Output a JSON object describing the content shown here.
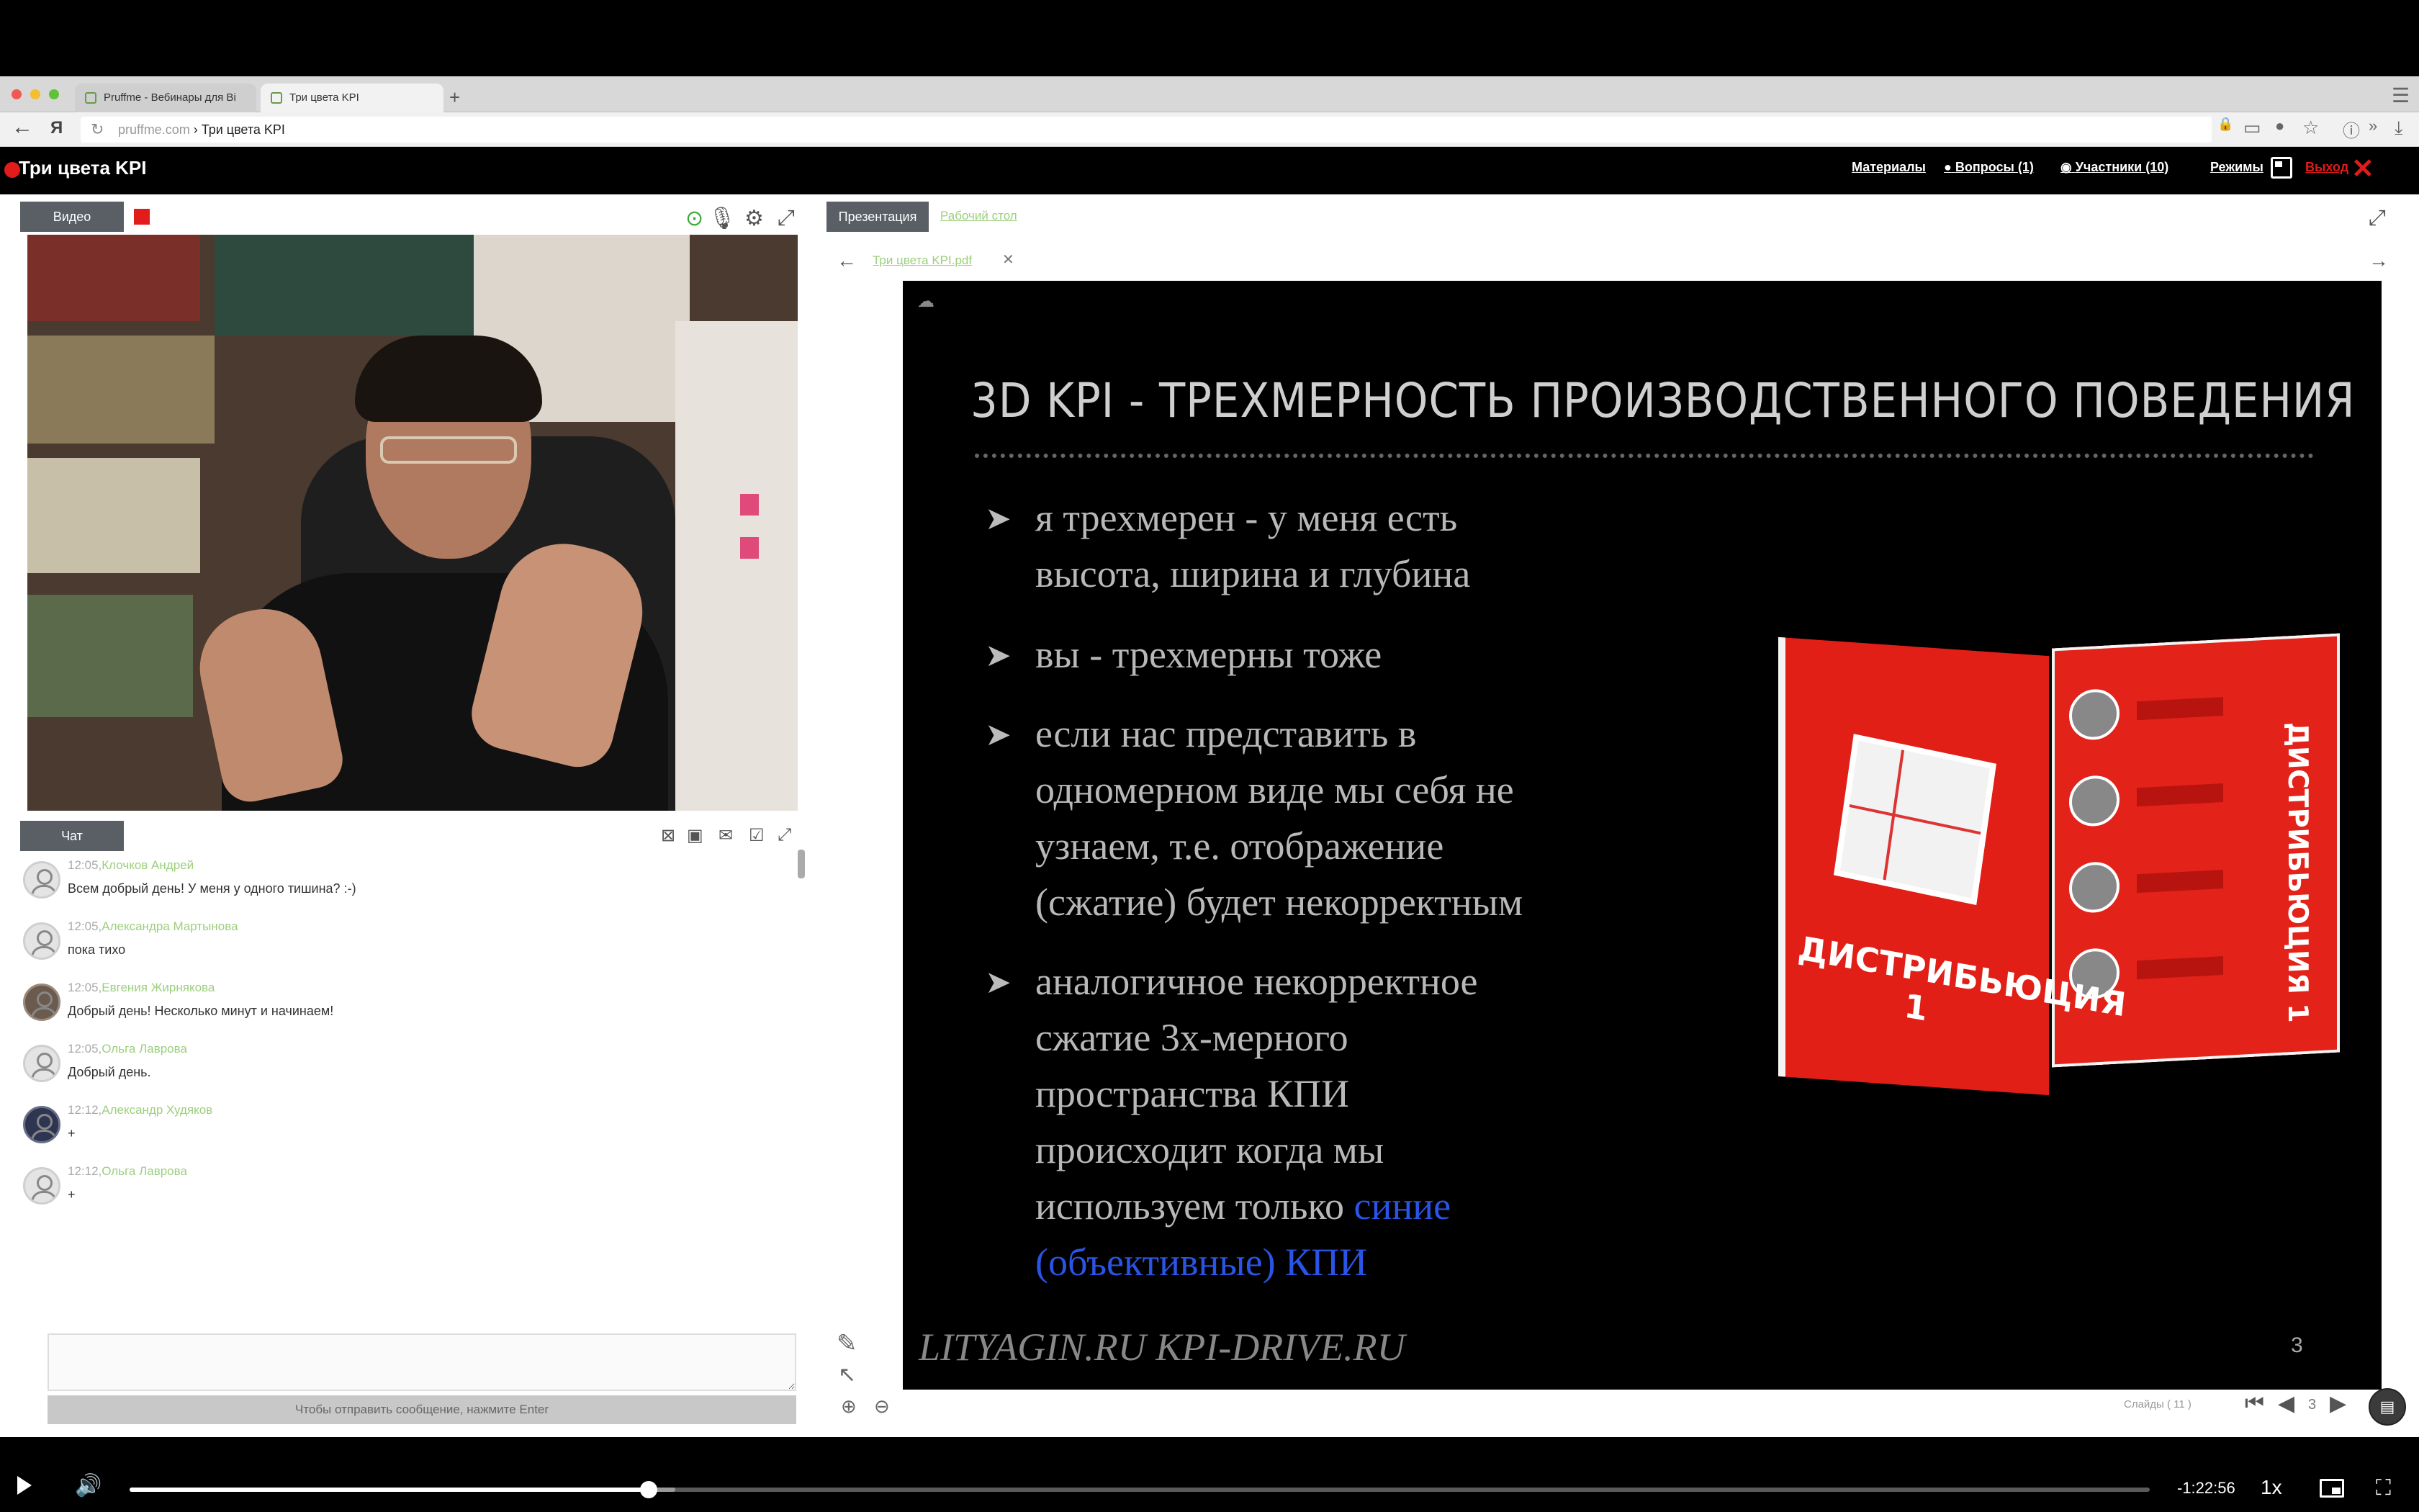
{
  "browser": {
    "tabs": [
      {
        "label": "Pruffme - Вебинары для Ві"
      },
      {
        "label": "Три цвета KPI"
      }
    ],
    "url_host": "pruffme.com",
    "url_separator": " › ",
    "url_title": "Три цвета KPI"
  },
  "header": {
    "title": "Три цвета KPI",
    "links": {
      "materials": "Материалы",
      "questions": "Вопросы (1)",
      "participants": "Участники (10)",
      "modes": "Режимы",
      "exit": "Выход"
    }
  },
  "video": {
    "tab_label": "Видео"
  },
  "chat": {
    "tab_label": "Чат",
    "messages": [
      {
        "time": "12:05,",
        "author": "Клочков Андрей",
        "text": "Всем добрый день! У меня у одного тишина? :-)"
      },
      {
        "time": "12:05,",
        "author": "Александра Мартынова",
        "text": "пока тихо"
      },
      {
        "time": "12:05,",
        "author": "Евгения Жирнякова",
        "text": "Добрый день! Несколько минут и начинаем!"
      },
      {
        "time": "12:05,",
        "author": "Ольга Лаврова",
        "text": "Добрый день."
      },
      {
        "time": "12:12,",
        "author": "Александр Худяков",
        "text": "+"
      },
      {
        "time": "12:12,",
        "author": "Ольга Лаврова",
        "text": "+"
      }
    ],
    "send_hint": "Чтобы отправить сообщение, нажмите Enter"
  },
  "presentation": {
    "tab_label": "Презентация",
    "desktop_tab": "Рабочий стол",
    "file_name": "Три цвета KPI.pdf",
    "slide": {
      "title": "3D  KPI - ТРЕХМЕРНОСТЬ ПРОИЗВОДСТВЕННОГО ПОВЕДЕНИЯ",
      "bullets": [
        {
          "lines": [
            "я трехмерен - у меня есть",
            "высота, ширина и глубина"
          ]
        },
        {
          "lines": [
            "вы - трехмерны тоже"
          ]
        },
        {
          "lines": [
            "если нас представить в",
            "одномерном виде мы себя не",
            "узнаем, т.е. отображение",
            "(сжатие) будет некорректным"
          ]
        },
        {
          "lines": [
            "аналогичное некорректное",
            "сжатие 3х-мерного",
            "пространства КПИ",
            "происходит когда мы"
          ],
          "tail_plain": "используем только ",
          "tail_blue": "синие",
          "last_blue": "(объективные) КПИ"
        }
      ],
      "book_title": "ДИСТРИБЬЮЦИЯ 1",
      "book_spine": "ДИСТРИБЬЮЦИЯ 1",
      "footer": "LITYAGIN.RU  KPI-DRIVE.RU",
      "number": "3"
    },
    "slides_label": "Слайды ( 11 )",
    "current_slide": "3"
  },
  "player": {
    "time_remaining": "-1:22:56",
    "speed": "1x",
    "progress_fraction": 0.257,
    "buffered_fraction": 0.27
  },
  "colors": {
    "accent_red": "#e21b1b",
    "link_green": "#9ccf7e",
    "slide_blue": "#2a54e6"
  }
}
